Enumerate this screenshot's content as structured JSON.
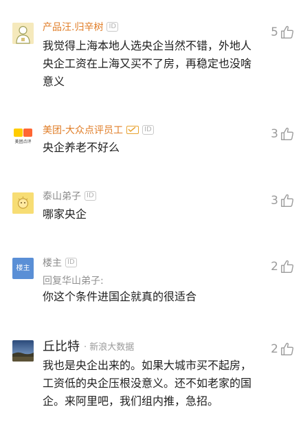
{
  "comments": [
    {
      "username": "产品汪.归辛树",
      "id_badge": "ID",
      "text": "我觉得上海本地人选央企当然不错，外地人央企工资在上海又买不了房，再稳定也没啥意义",
      "likes": "5"
    },
    {
      "username": "美团-大众点评员工",
      "id_badge": "ID",
      "avatar_text": "美团点评",
      "text": "央企养老不好么",
      "likes": "3"
    },
    {
      "username": "泰山弟子",
      "id_badge": "ID",
      "text": "哪家央企",
      "likes": "3"
    },
    {
      "username": "楼主",
      "id_badge": "ID",
      "avatar_text": "楼主",
      "reply_to": "回复华山弟子:",
      "text": "你这个条件进国企就真的很适合",
      "likes": "2"
    },
    {
      "username": "丘比特",
      "source": "· 新浪大数据",
      "text": "我也是央企出来的。如果大城市买不起房，工资低的央企压根没意义。还不如老家的国企。来阿里吧，我们组内推，急招。",
      "likes": "2"
    }
  ],
  "colors": {
    "brand_name": "#e07d27",
    "meituan_yellow": "#ffcc00",
    "louzhu_blue": "#5a8fd6"
  }
}
